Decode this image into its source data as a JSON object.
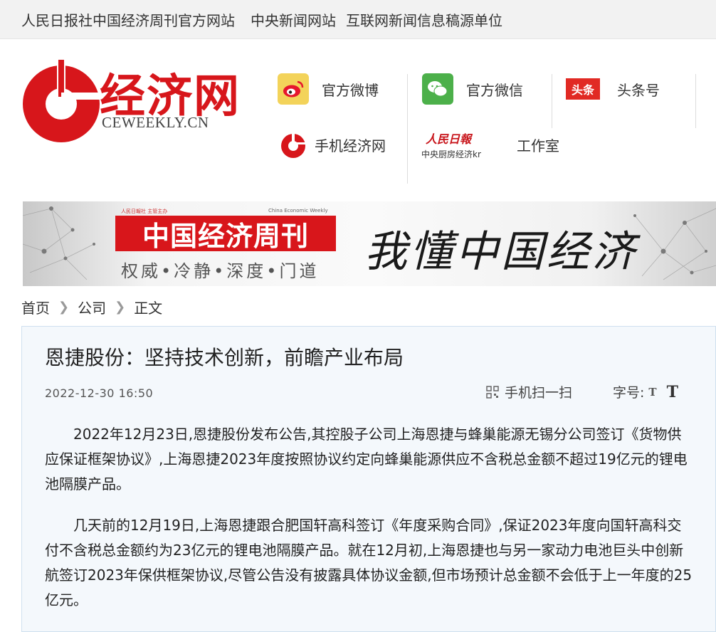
{
  "topbar": {
    "item1": "人民日报社中国经济周刊官方网站",
    "item2": "中央新闻网站",
    "item3": "互联网新闻信息稿源单位"
  },
  "logo": {
    "name": "经济网",
    "domain": "CEWEEKLY.CN",
    "color": "#d7161b"
  },
  "header_links": {
    "weibo": "官方微博",
    "wechat": "官方微信",
    "toutiao_icon": "头条",
    "toutiao": "头条号",
    "mobile": "手机经济网",
    "studio": "工作室",
    "studio_logo_top": "人民日報",
    "studio_logo_bottom": "中央厨房经济kr"
  },
  "banner": {
    "masthead": "中国经济周刊",
    "mini_left": "人民日報社 主管主办",
    "mini_right": "China Economic Weekly",
    "motto": "权威•冷静•深度•门道",
    "slogan": "我懂中国经济"
  },
  "breadcrumb": {
    "home": "首页",
    "category": "公司",
    "current": "正文"
  },
  "article": {
    "title": "恩捷股份：坚持技术创新，前瞻产业布局",
    "date": "2022-12-30 16:50",
    "scan_label": "手机扫一扫",
    "font_label": "字号:",
    "font_small": "T",
    "font_big": "T",
    "paragraphs": [
      "2022年12月23日,恩捷股份发布公告,其控股子公司上海恩捷与蜂巢能源无锡分公司签订《货物供应保证框架协议》,上海恩捷2023年度按照协议约定向蜂巢能源供应不含税总金额不超过19亿元的锂电池隔膜产品。",
      "几天前的12月19日,上海恩捷跟合肥国轩高科签订《年度采购合同》,保证2023年度向国轩高科交付不含税总金额约为23亿元的锂电池隔膜产品。就在12月初,上海恩捷也与另一家动力电池巨头中创新航签订2023年保供框架协议,尽管公告没有披露具体协议金额,但市场预计总金额不会低于上一年度的25亿元。"
    ]
  }
}
